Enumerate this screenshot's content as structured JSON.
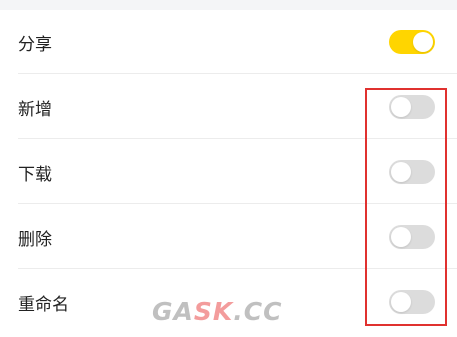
{
  "settings": {
    "items": [
      {
        "label": "分享",
        "enabled": true
      },
      {
        "label": "新增",
        "enabled": false
      },
      {
        "label": "下载",
        "enabled": false
      },
      {
        "label": "删除",
        "enabled": false
      },
      {
        "label": "重命名",
        "enabled": false
      }
    ]
  },
  "colors": {
    "toggle_on": "#ffd500",
    "toggle_off": "#dcdcdc",
    "highlight_border": "#e0312f"
  },
  "watermark": {
    "part1": "GA",
    "part2": "SK",
    "part3": ".CC"
  }
}
